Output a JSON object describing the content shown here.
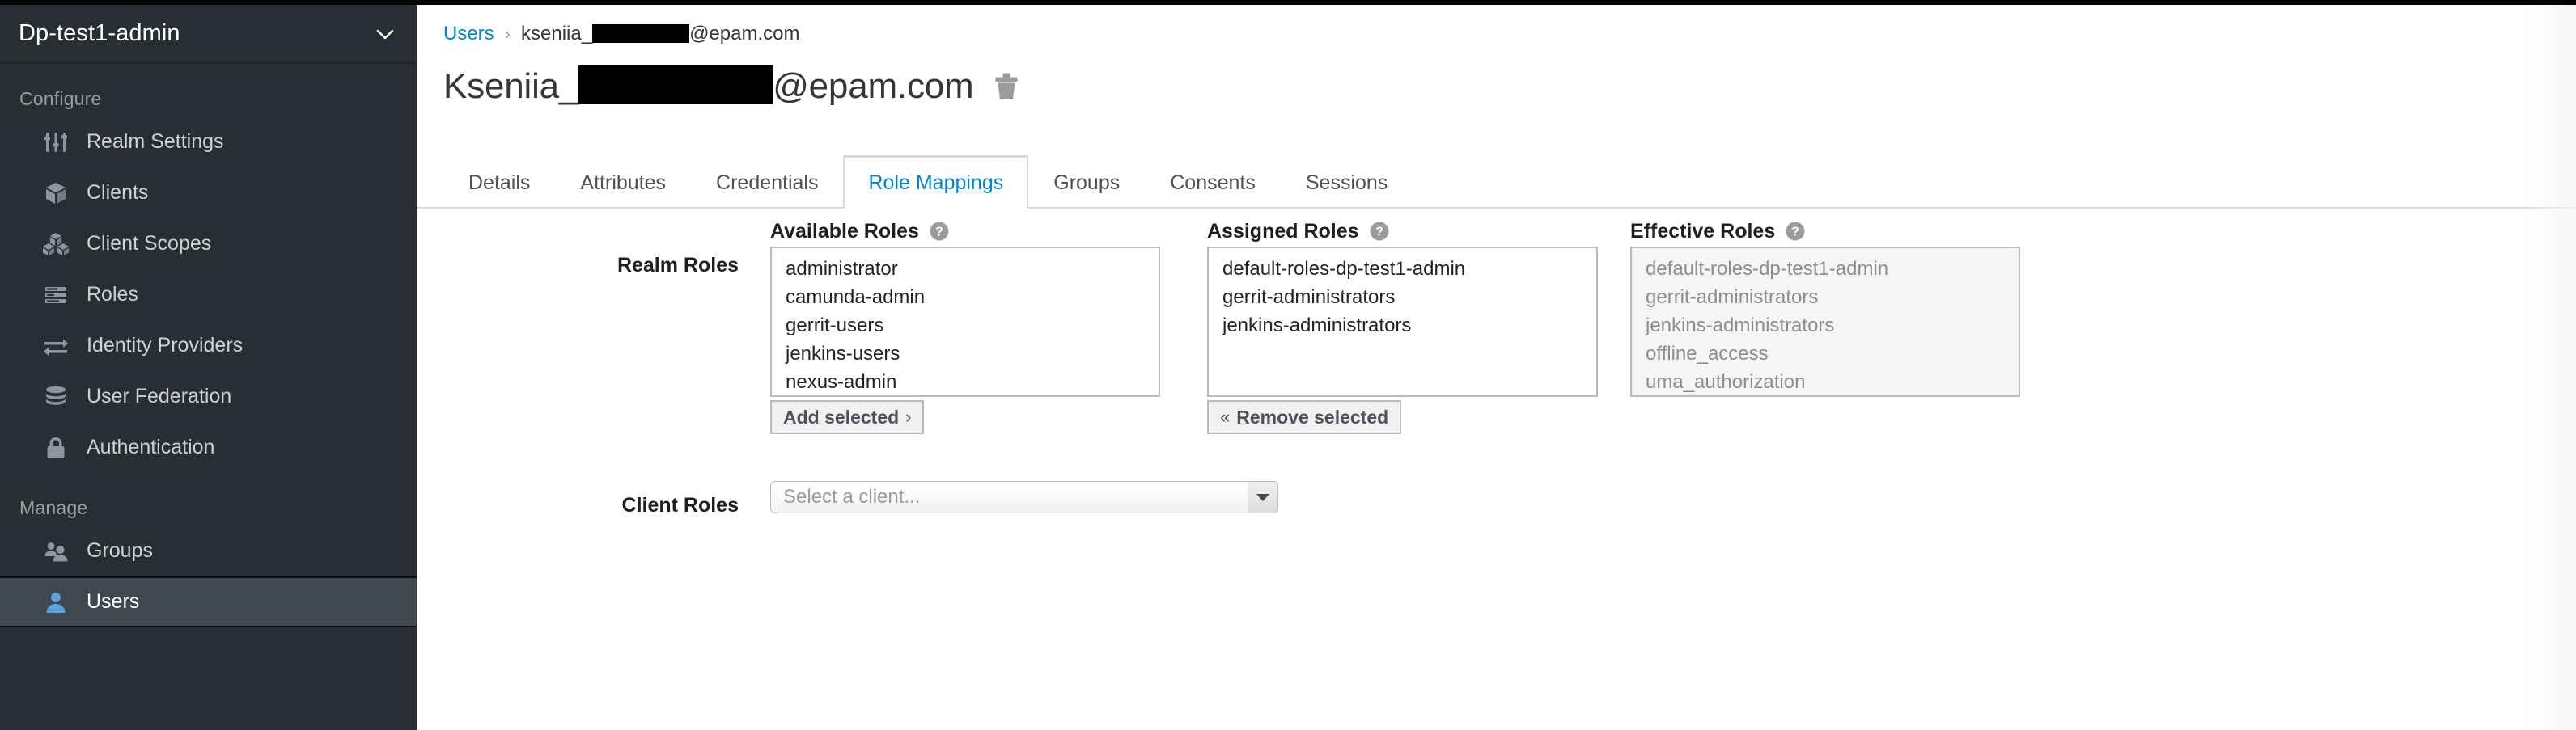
{
  "colors": {
    "sidebar_bg": "#292e34",
    "sidebar_active_bg": "#3f4850",
    "accent_blue": "#0088ce",
    "text_dark": "#363636",
    "muted": "#8b8d8f"
  },
  "sidebar": {
    "realm_name": "Dp-test1-admin",
    "realm_caret_icon": "chevron-down-icon",
    "sections": [
      {
        "label": "Configure",
        "items": [
          {
            "label": "Realm Settings",
            "icon": "sliders-icon",
            "active": false
          },
          {
            "label": "Clients",
            "icon": "cube-icon",
            "active": false
          },
          {
            "label": "Client Scopes",
            "icon": "cubes-icon",
            "active": false
          },
          {
            "label": "Roles",
            "icon": "list-rows-icon",
            "active": false
          },
          {
            "label": "Identity Providers",
            "icon": "exchange-arrows-icon",
            "active": false
          },
          {
            "label": "User Federation",
            "icon": "database-icon",
            "active": false
          },
          {
            "label": "Authentication",
            "icon": "lock-icon",
            "active": false
          }
        ]
      },
      {
        "label": "Manage",
        "items": [
          {
            "label": "Groups",
            "icon": "users-group-icon",
            "active": false
          },
          {
            "label": "Users",
            "icon": "user-icon",
            "active": true
          }
        ]
      }
    ]
  },
  "breadcrumb": {
    "root_label": "Users",
    "separator": "›",
    "current_prefix": "kseniia_",
    "current_suffix": "@epam.com",
    "current_redacted": true
  },
  "page": {
    "title_prefix": "Kseniia_",
    "title_suffix": "@epam.com",
    "title_redacted": true,
    "delete_icon": "trash-icon"
  },
  "tabs": [
    {
      "label": "Details",
      "active": false
    },
    {
      "label": "Attributes",
      "active": false
    },
    {
      "label": "Credentials",
      "active": false
    },
    {
      "label": "Role Mappings",
      "active": true
    },
    {
      "label": "Groups",
      "active": false
    },
    {
      "label": "Consents",
      "active": false
    },
    {
      "label": "Sessions",
      "active": false
    }
  ],
  "role_mappings": {
    "realm_roles_label": "Realm Roles",
    "client_roles_label": "Client Roles",
    "help_icon": "question-circle-icon",
    "available": {
      "heading": "Available Roles",
      "options": [
        "administrator",
        "camunda-admin",
        "gerrit-users",
        "jenkins-users",
        "nexus-admin"
      ],
      "button_label": "Add selected",
      "button_arrow": "›"
    },
    "assigned": {
      "heading": "Assigned Roles",
      "options": [
        "default-roles-dp-test1-admin",
        "gerrit-administrators",
        "jenkins-administrators"
      ],
      "button_label": "Remove selected",
      "button_arrow": "«"
    },
    "effective": {
      "heading": "Effective Roles",
      "options": [
        "default-roles-dp-test1-admin",
        "gerrit-administrators",
        "jenkins-administrators",
        "offline_access",
        "uma_authorization"
      ],
      "disabled": true
    },
    "client_select": {
      "placeholder": "Select a client...",
      "value": "",
      "caret_icon": "caret-down-icon"
    }
  }
}
